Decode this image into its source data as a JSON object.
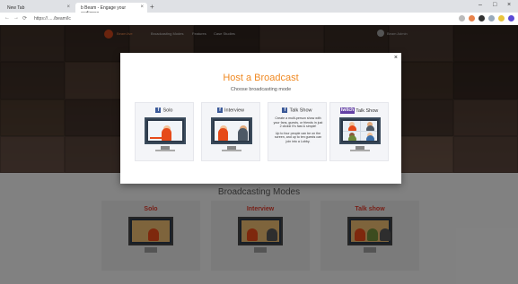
{
  "browser": {
    "tabs": [
      {
        "label": "New Tab"
      },
      {
        "label": "b Beam - Engage your audience"
      }
    ],
    "new_tab_symbol": "+",
    "url": "https://...../beam/lc",
    "window_controls": [
      "–",
      "□",
      "×"
    ],
    "nav": [
      "←",
      "→",
      "⟳"
    ]
  },
  "site": {
    "nav": {
      "logo_text": "Beam.live",
      "links": [
        "Broadcasting Modes",
        "Features",
        "Case Studies"
      ],
      "user_name": "Beam Admin"
    },
    "section_title": "Broadcasting Modes",
    "mode_cards": [
      {
        "title": "Solo"
      },
      {
        "title": "Interview"
      },
      {
        "title": "Talk show"
      }
    ]
  },
  "modal": {
    "close_symbol": "×",
    "title": "Host a Broadcast",
    "subtitle": "Choose broadcasting mode",
    "options": [
      {
        "label": "Solo",
        "badge": "f"
      },
      {
        "label": "Interview",
        "badge": "f"
      },
      {
        "label": "Talk Show",
        "badge": "f",
        "description": [
          "Create a multi-person show with your fans, guests, or friends in just 2 clicks! It's fast & simple!",
          "Up to four people can be on the screen, and up to ten guests can join into a Lobby."
        ]
      },
      {
        "label": "Talk Show",
        "badge": "twitch"
      }
    ]
  },
  "colors": {
    "accent_orange": "#f08a24",
    "mode_red": "#d93a2b",
    "facebook_blue": "#3b5998",
    "twitch_purple": "#6441a5"
  }
}
